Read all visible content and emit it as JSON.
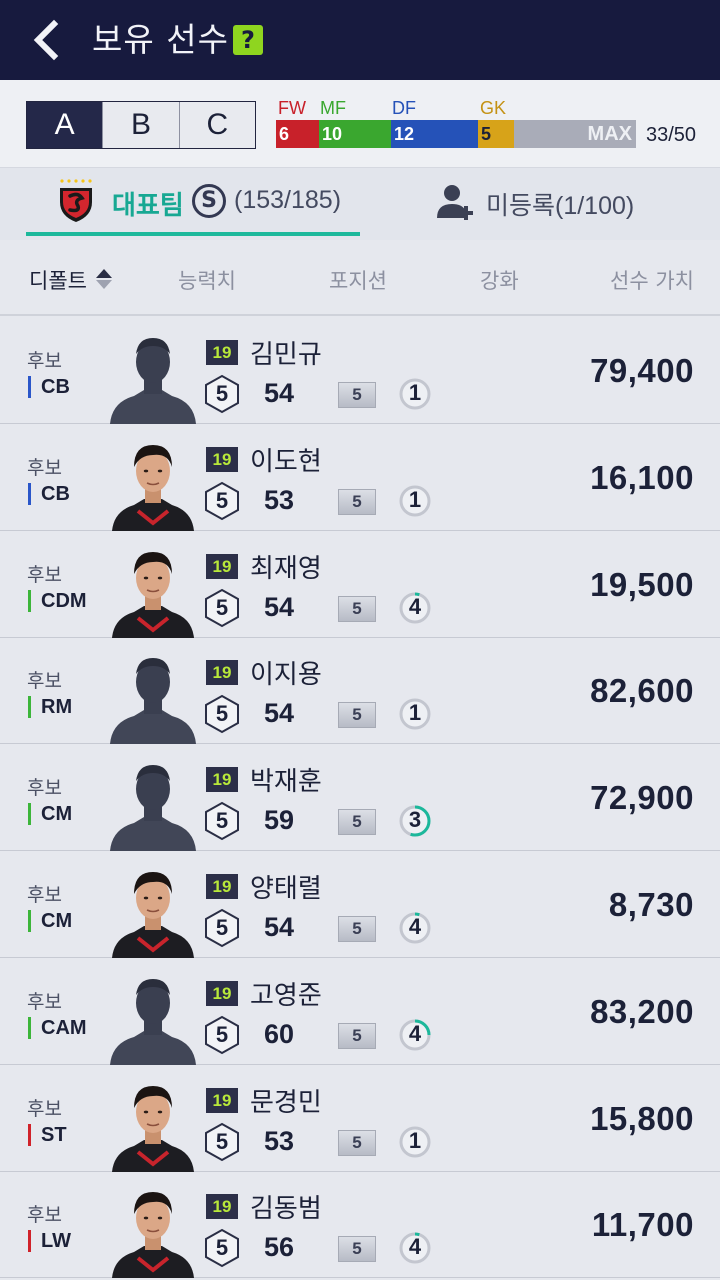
{
  "header": {
    "title": "보유 선수",
    "help_label": "?"
  },
  "squad_tabs": [
    "A",
    "B",
    "C"
  ],
  "active_squad": "A",
  "positions": {
    "fw": {
      "label": "FW",
      "count": "6",
      "color": "#c8212a"
    },
    "mf": {
      "label": "MF",
      "count": "10",
      "color": "#3aa72f"
    },
    "df": {
      "label": "DF",
      "count": "12",
      "color": "#2552b8"
    },
    "gk": {
      "label": "GK",
      "count": "5",
      "color": "#d7a319"
    },
    "max_label": "MAX",
    "total": "33/50"
  },
  "team_tabs": {
    "main_label": "대표팀",
    "main_badge": "S",
    "main_count": "(153/185)",
    "unregistered_label": "미등록(1/100)"
  },
  "sort": {
    "default": "디폴트",
    "ability": "능력치",
    "position": "포지션",
    "enhance": "강화",
    "value": "선수 가치"
  },
  "players": [
    {
      "status": "후보",
      "position": "CB",
      "line": "def",
      "season": "19",
      "name": "김민규",
      "grade": "5",
      "ovr": "54",
      "enhance": "5",
      "trade": "1",
      "trade_progress": 0,
      "photo": "silhouette",
      "value": "79,400"
    },
    {
      "status": "후보",
      "position": "CB",
      "line": "def",
      "season": "19",
      "name": "이도현",
      "grade": "5",
      "ovr": "53",
      "enhance": "5",
      "trade": "1",
      "trade_progress": 0,
      "photo": "photo",
      "value": "16,100"
    },
    {
      "status": "후보",
      "position": "CDM",
      "line": "mid",
      "season": "19",
      "name": "최재영",
      "grade": "5",
      "ovr": "54",
      "enhance": "5",
      "trade": "4",
      "trade_progress": 0.05,
      "photo": "photo",
      "value": "19,500"
    },
    {
      "status": "후보",
      "position": "RM",
      "line": "mid",
      "season": "19",
      "name": "이지용",
      "grade": "5",
      "ovr": "54",
      "enhance": "5",
      "trade": "1",
      "trade_progress": 0,
      "photo": "silhouette",
      "value": "82,600"
    },
    {
      "status": "후보",
      "position": "CM",
      "line": "mid",
      "season": "19",
      "name": "박재훈",
      "grade": "5",
      "ovr": "59",
      "enhance": "5",
      "trade": "3",
      "trade_progress": 0.55,
      "photo": "silhouette",
      "value": "72,900"
    },
    {
      "status": "후보",
      "position": "CM",
      "line": "mid",
      "season": "19",
      "name": "양태렬",
      "grade": "5",
      "ovr": "54",
      "enhance": "5",
      "trade": "4",
      "trade_progress": 0.05,
      "photo": "photo",
      "value": "8,730"
    },
    {
      "status": "후보",
      "position": "CAM",
      "line": "mid",
      "season": "19",
      "name": "고영준",
      "grade": "5",
      "ovr": "60",
      "enhance": "5",
      "trade": "4",
      "trade_progress": 0.25,
      "photo": "silhouette",
      "value": "83,200"
    },
    {
      "status": "후보",
      "position": "ST",
      "line": "att",
      "season": "19",
      "name": "문경민",
      "grade": "5",
      "ovr": "53",
      "enhance": "5",
      "trade": "1",
      "trade_progress": 0,
      "photo": "photo",
      "value": "15,800"
    },
    {
      "status": "후보",
      "position": "LW",
      "line": "att",
      "season": "19",
      "name": "김동범",
      "grade": "5",
      "ovr": "56",
      "enhance": "5",
      "trade": "4",
      "trade_progress": 0.05,
      "photo": "photo",
      "value": "11,700"
    }
  ]
}
